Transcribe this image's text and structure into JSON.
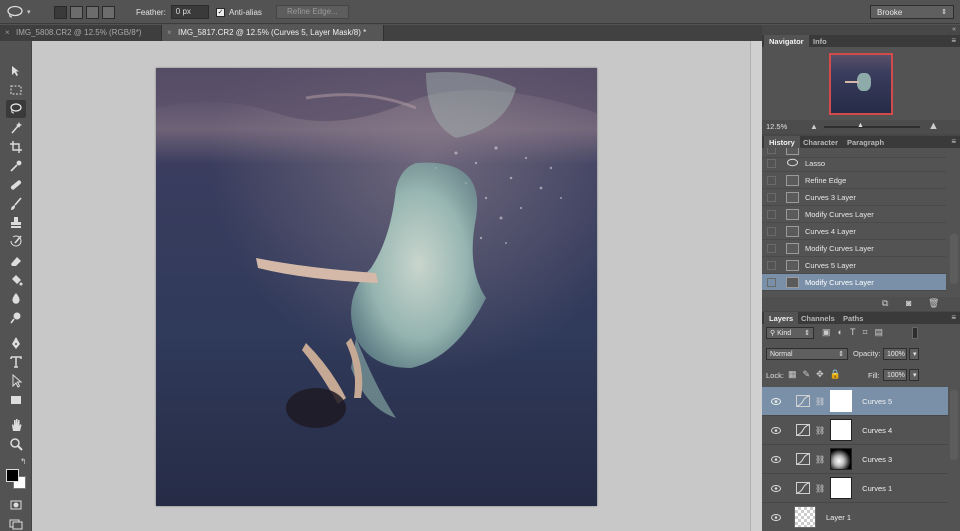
{
  "options_bar": {
    "feather_label": "Feather:",
    "feather_value": "0 px",
    "anti_alias_label": "Anti-alias",
    "anti_alias_checked": true,
    "refine_edge_label": "Refine Edge...",
    "workspace_value": "Brooke"
  },
  "tabs": [
    {
      "label": "IMG_5808.CR2 @ 12.5% (RGB/8*)",
      "active": false
    },
    {
      "label": "IMG_5817.CR2 @ 12.5% (Curves 5, Layer Mask/8) *",
      "active": true
    }
  ],
  "navigator": {
    "tab_navigator": "Navigator",
    "tab_info": "Info",
    "zoom": "12.5%"
  },
  "history": {
    "tab_history": "History",
    "tab_character": "Character",
    "tab_paragraph": "Paragraph",
    "items": [
      {
        "label": "Lasso",
        "selected": false
      },
      {
        "label": "Refine Edge",
        "selected": false
      },
      {
        "label": "Curves 3 Layer",
        "selected": false
      },
      {
        "label": "Modify Curves Layer",
        "selected": false
      },
      {
        "label": "Curves 4 Layer",
        "selected": false
      },
      {
        "label": "Modify Curves Layer",
        "selected": false
      },
      {
        "label": "Curves 5 Layer",
        "selected": false
      },
      {
        "label": "Modify Curves Layer",
        "selected": true
      }
    ]
  },
  "layers": {
    "tab_layers": "Layers",
    "tab_channels": "Channels",
    "tab_paths": "Paths",
    "filter_kind": "Kind",
    "blend_mode": "Normal",
    "opacity_label": "Opacity:",
    "opacity_value": "100%",
    "lock_label": "Lock:",
    "fill_label": "Fill:",
    "fill_value": "100%",
    "items": [
      {
        "name": "Curves 5",
        "selected": true,
        "mask": "white"
      },
      {
        "name": "Curves 4",
        "selected": false,
        "mask": "white"
      },
      {
        "name": "Curves 3",
        "selected": false,
        "mask": "radial"
      },
      {
        "name": "Curves 1",
        "selected": false,
        "mask": "white"
      },
      {
        "name": "Layer 1",
        "selected": false,
        "mask": "transparent"
      }
    ]
  },
  "colors": {
    "selection_blue": "#7a90a8",
    "panel_bg": "#535353",
    "canvas_bg": "#c8c8c8"
  }
}
